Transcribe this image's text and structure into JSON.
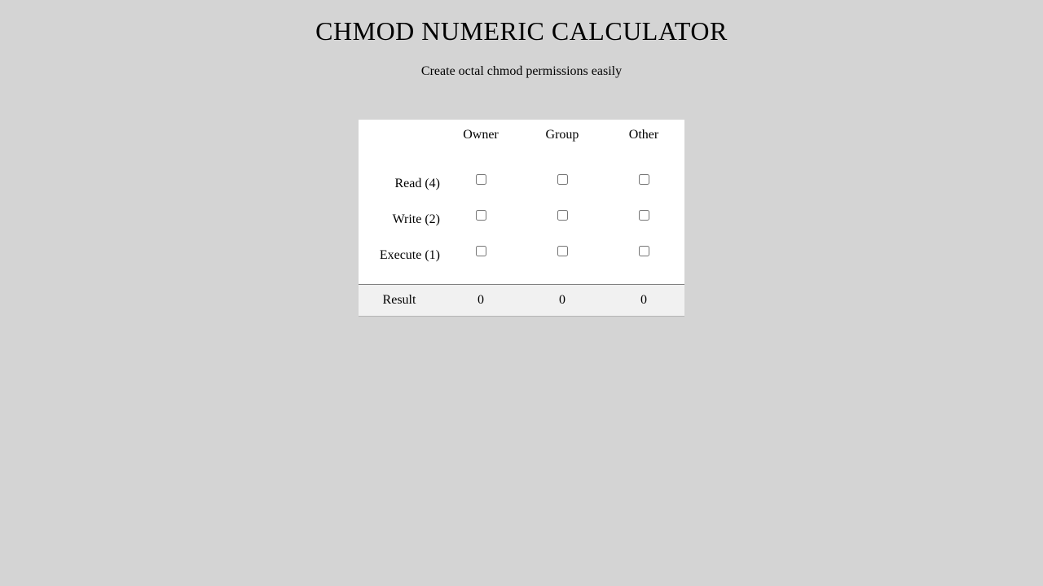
{
  "header": {
    "title": "CHMOD NUMERIC CALCULATOR",
    "subtitle": "Create octal chmod permissions easily"
  },
  "columns": {
    "owner": "Owner",
    "group": "Group",
    "other": "Other"
  },
  "rows": {
    "read": "Read (4)",
    "write": "Write (2)",
    "execute": "Execute (1)"
  },
  "result": {
    "label": "Result",
    "owner": "0",
    "group": "0",
    "other": "0"
  }
}
